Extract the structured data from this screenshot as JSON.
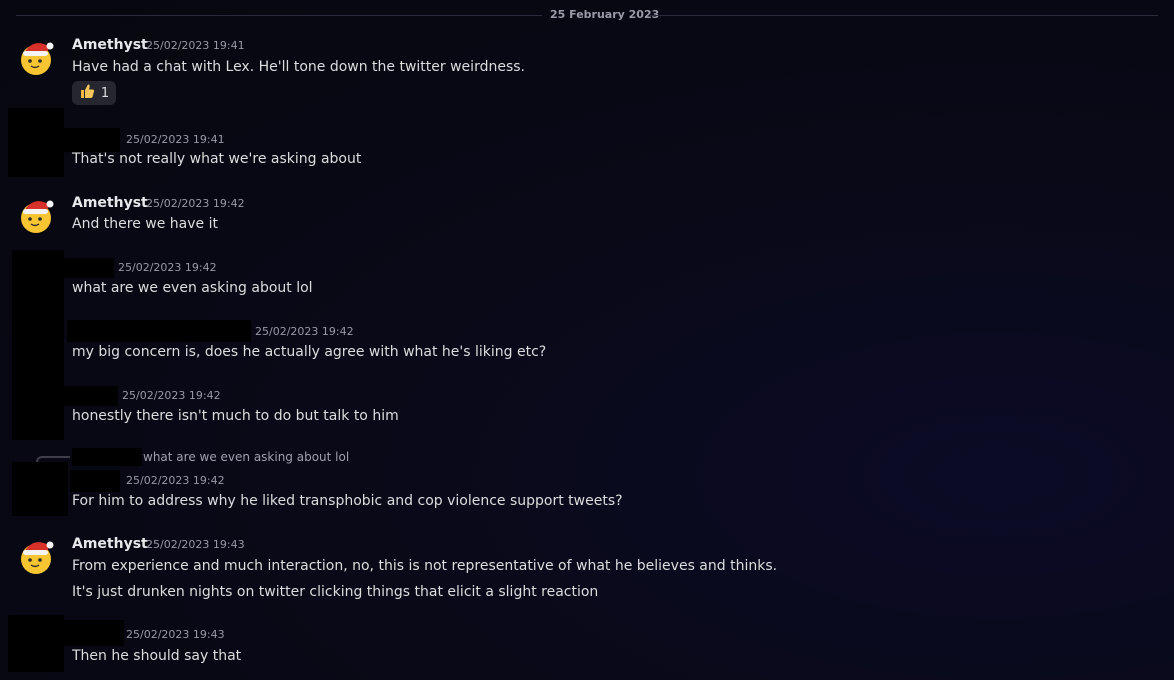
{
  "divider": {
    "date": "25 February 2023"
  },
  "messages": [
    {
      "author": "Amethyst",
      "timestamp": "25/02/2023 19:41",
      "lines": [
        "Have had a chat with Lex. He'll tone down the twitter weirdness."
      ],
      "reaction": {
        "icon": "thumbs-up",
        "count": "1"
      }
    },
    {
      "author": "",
      "timestamp": "25/02/2023 19:41",
      "lines": [
        "That's not really what we're asking about"
      ]
    },
    {
      "author": "Amethyst",
      "timestamp": "25/02/2023 19:42",
      "lines": [
        "And there we have it"
      ]
    },
    {
      "author": "",
      "timestamp": "25/02/2023 19:42",
      "lines": [
        "what are we even asking about lol"
      ]
    },
    {
      "author": "",
      "timestamp": "25/02/2023 19:42",
      "lines": [
        "my big concern is, does he actually agree with what he's liking etc?"
      ]
    },
    {
      "author": "",
      "timestamp": "25/02/2023 19:42",
      "lines": [
        "honestly there isn't much to do but talk to him"
      ]
    },
    {
      "author": "",
      "timestamp": "25/02/2023 19:42",
      "reply_to": "what are we even asking about lol",
      "lines": [
        "For him to address why he liked transphobic and cop violence support tweets?"
      ]
    },
    {
      "author": "Amethyst",
      "timestamp": "25/02/2023 19:43",
      "lines": [
        "From experience and much interaction, no, this is not representative of what he believes and thinks.",
        "It's just drunken nights on twitter clicking things that elicit a slight reaction"
      ]
    },
    {
      "author": "",
      "timestamp": "25/02/2023 19:43",
      "lines": [
        "Then he should say that"
      ]
    }
  ]
}
